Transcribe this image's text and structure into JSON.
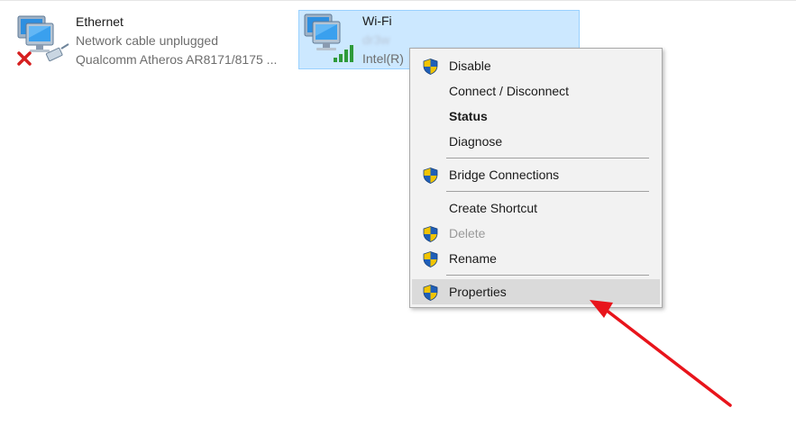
{
  "adapters": {
    "ethernet": {
      "name": "Ethernet",
      "status": "Network cable unplugged",
      "device": "Qualcomm Atheros AR8171/8175 ..."
    },
    "wifi": {
      "name": "Wi-Fi",
      "network": "dr3w",
      "device": "Intel(R)"
    }
  },
  "context_menu": {
    "items": [
      {
        "label": "Disable",
        "shield": true
      },
      {
        "label": "Connect / Disconnect",
        "shield": false
      },
      {
        "label": "Status",
        "shield": false,
        "bold": true
      },
      {
        "label": "Diagnose",
        "shield": false
      },
      {
        "label": "Bridge Connections",
        "shield": true
      },
      {
        "label": "Create Shortcut",
        "shield": false
      },
      {
        "label": "Delete",
        "shield": true,
        "disabled": true
      },
      {
        "label": "Rename",
        "shield": true
      },
      {
        "label": "Properties",
        "shield": true,
        "highlighted": true
      }
    ]
  },
  "colors": {
    "selection_bg": "#cce8ff",
    "selection_border": "#99d1ff",
    "menu_bg": "#f2f2f2",
    "hover_bg": "#dadada",
    "annotation_arrow": "#e8141b"
  }
}
